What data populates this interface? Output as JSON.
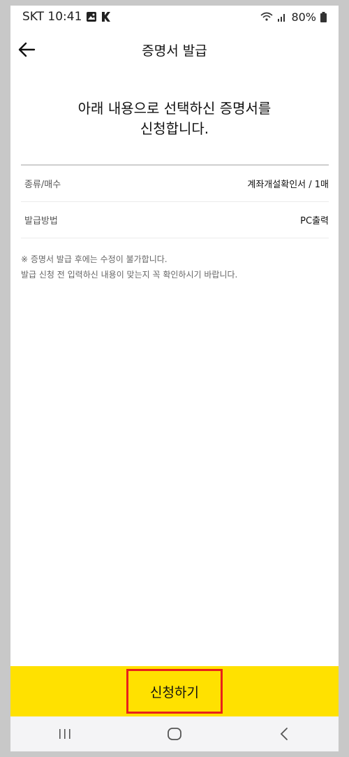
{
  "status_bar": {
    "carrier_time": "SKT 10:41",
    "battery": "80%",
    "icons": [
      "gallery-icon",
      "k-app-icon",
      "wifi-icon",
      "signal-icon",
      "battery-icon"
    ]
  },
  "header": {
    "title": "증명서 발급",
    "back_icon": "arrow-left-icon"
  },
  "headline": {
    "line1": "아래 내용으로 선택하신 증명서를",
    "line2": "신청합니다."
  },
  "summary": {
    "rows": [
      {
        "label": "종류/매수",
        "value": "계좌개설확인서 / 1매"
      },
      {
        "label": "발급방법",
        "value": "PC출력"
      }
    ]
  },
  "notice": {
    "line1": "※ 증명서 발급 후에는 수정이 불가합니다.",
    "line2": "발급 신청 전 입력하신 내용이 맞는지 꼭 확인하시기 바랍니다."
  },
  "action": {
    "apply_label": "신청하기"
  },
  "nav_bar": {
    "icons": [
      "recent-apps-icon",
      "home-icon",
      "back-nav-icon"
    ]
  },
  "colors": {
    "action_bar": "#ffe100",
    "highlight_border": "#e8221b"
  }
}
